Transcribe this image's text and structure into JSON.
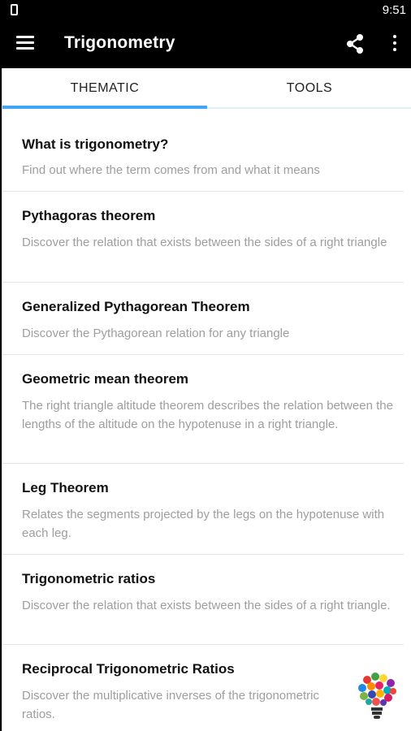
{
  "status_bar": {
    "time": "9:51"
  },
  "app_bar": {
    "title": "Trigonometry"
  },
  "tabs": [
    {
      "label": "THEMATIC",
      "selected": true
    },
    {
      "label": "TOOLS",
      "selected": false
    }
  ],
  "colors": {
    "accent": "#42a5f5",
    "app_bar_bg": "#000000",
    "desc_text": "#9e9e9e"
  },
  "icons": {
    "menu": "hamburger-menu-icon",
    "share": "share-icon",
    "more": "more-vert-icon",
    "bulb": "lightbulb-icon"
  },
  "items": [
    {
      "title": "What is trigonometry?",
      "desc": "Find out where the term comes from and what it means"
    },
    {
      "title": "Pythagoras theorem",
      "desc": "Discover the relation that exists between the sides of a right triangle"
    },
    {
      "title": "Generalized Pythagorean Theorem",
      "desc": "Discover the Pythagorean relation for any triangle"
    },
    {
      "title": "Geometric mean theorem",
      "desc": "The right triangle altitude theorem describes the relation between the lengths of the altitude on the hypotenuse in a right triangle."
    },
    {
      "title": "Leg Theorem",
      "desc": "Relates the segments projected by the legs on the hypotenuse with each leg."
    },
    {
      "title": "Trigonometric ratios",
      "desc": "Discover the relation that exists between the sides of a right triangle."
    },
    {
      "title": "Reciprocal Trigonometric Ratios",
      "desc": "Discover the multiplicative inverses of the trigonometric ratios."
    }
  ]
}
